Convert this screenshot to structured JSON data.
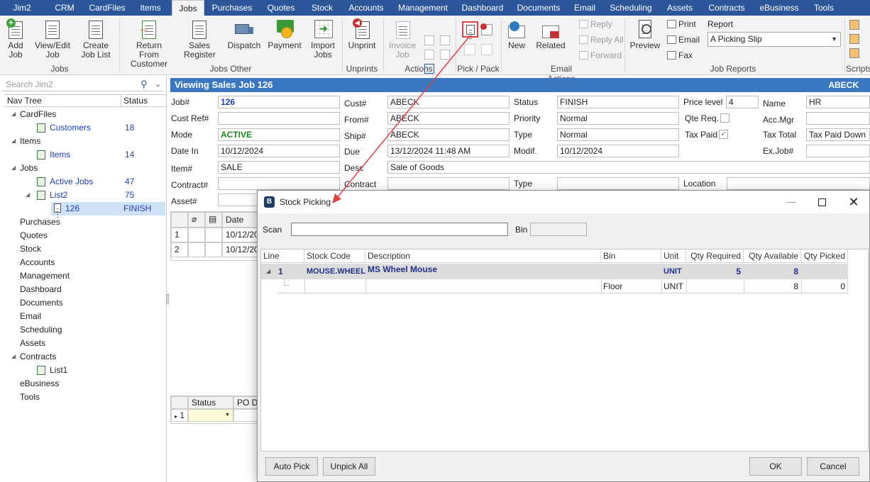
{
  "menubar": {
    "items": [
      "Jim2",
      "CRM",
      "CardFiles",
      "Items",
      "Jobs",
      "Purchases",
      "Quotes",
      "Stock",
      "Accounts",
      "Management",
      "Dashboard",
      "Documents",
      "Email",
      "Scheduling",
      "Assets",
      "Contracts",
      "eBusiness",
      "Tools"
    ],
    "active": "Jobs"
  },
  "ribbon": {
    "add_job": "Add Job",
    "view_edit_job": "View/Edit Job",
    "create_job_list": "Create Job List",
    "group_jobs": "Jobs",
    "return_from_customer": "Return From Customer",
    "sales_register": "Sales Register",
    "dispatch": "Dispatch",
    "payment": "Payment",
    "import_jobs": "Import Jobs",
    "group_jobs_other": "Jobs Other",
    "unprint": "Unprint",
    "group_unprints": "Unprints",
    "invoice_job": "Invoice Job",
    "group_actions": "Actions",
    "group_pick_pack": "Pick / Pack",
    "new": "New",
    "related": "Related",
    "reply": "Reply",
    "reply_all": "Reply All",
    "forward": "Forward",
    "group_email_actions": "Email Actions",
    "preview": "Preview",
    "print": "Print",
    "email": "Email",
    "fax": "Fax",
    "report_label": "Report",
    "report_value": "A Picking Slip",
    "group_job_reports": "Job Reports",
    "group_scripts": "Scripts"
  },
  "nav": {
    "search_placeholder": "Search Jim2",
    "col_tree": "Nav Tree",
    "col_status": "Status",
    "rows": [
      {
        "label": "CardFiles",
        "status": ""
      },
      {
        "label": "Customers",
        "status": "18"
      },
      {
        "label": "Items",
        "status": ""
      },
      {
        "label": "Items",
        "status": "14"
      },
      {
        "label": "Jobs",
        "status": ""
      },
      {
        "label": "Active Jobs",
        "status": "47"
      },
      {
        "label": "List2",
        "status": "75"
      },
      {
        "label": "126",
        "status": "FINISH"
      },
      {
        "label": "Purchases",
        "status": ""
      },
      {
        "label": "Quotes",
        "status": ""
      },
      {
        "label": "Stock",
        "status": ""
      },
      {
        "label": "Accounts",
        "status": ""
      },
      {
        "label": "Management",
        "status": ""
      },
      {
        "label": "Dashboard",
        "status": ""
      },
      {
        "label": "Documents",
        "status": ""
      },
      {
        "label": "Email",
        "status": ""
      },
      {
        "label": "Scheduling",
        "status": ""
      },
      {
        "label": "Assets",
        "status": ""
      },
      {
        "label": "Contracts",
        "status": ""
      },
      {
        "label": "List1",
        "status": ""
      },
      {
        "label": "eBusiness",
        "status": ""
      },
      {
        "label": "Tools",
        "status": ""
      }
    ]
  },
  "job": {
    "title": "Viewing Sales Job 126",
    "title_right": "ABECK",
    "labels": {
      "job_no": "Job#",
      "cust_ref": "Cust Ref#",
      "mode": "Mode",
      "date_in": "Date In",
      "item": "Item#",
      "contract": "Contract#",
      "asset": "Asset#",
      "cust": "Cust#",
      "from": "From#",
      "ship": "Ship#",
      "due": "Due",
      "desc": "Desc",
      "contract2": "Contract",
      "status": "Status",
      "priority": "Priority",
      "type": "Type",
      "modif": "Modif.",
      "type2": "Type",
      "price_level": "Price level",
      "qte_req": "Qte Req.",
      "tax_paid": "Tax Paid",
      "location": "Location",
      "name": "Name",
      "acc_mgr": "Acc.Mgr",
      "tax_total": "Tax Total",
      "ex_job": "Ex.Job#"
    },
    "values": {
      "job_no": "126",
      "cust_ref": "",
      "mode": "ACTIVE",
      "date_in": "10/12/2024",
      "item": "SALE",
      "cust": "ABECK",
      "from": "ABECK",
      "ship": "ABECK",
      "due": "13/12/2024 11:48 AM",
      "desc": "Sale of Goods",
      "status": "FINISH",
      "priority": "Normal",
      "type": "Normal",
      "modif": "10/12/2024",
      "price_level": "4",
      "tax_paid_check": "✓",
      "name": "HR",
      "tax_total": "Tax Paid Down"
    }
  },
  "left_grid": {
    "date_header": "Date",
    "rows": [
      {
        "n": "1",
        "date": "10/12/2024"
      },
      {
        "n": "2",
        "date": "10/12/2024"
      }
    ]
  },
  "lower_grid": {
    "status_header": "Status",
    "po_due_header": "PO Due",
    "row_no": "1"
  },
  "dialog": {
    "title": "Stock Picking",
    "scan_label": "Scan",
    "scan_value": "",
    "bin_label": "Bin",
    "bin_value": "",
    "columns": [
      "Line",
      "Stock Code",
      "Description",
      "Bin",
      "Unit",
      "Qty Required",
      "Qty Available",
      "Qty Picked"
    ],
    "main_row": {
      "line": "1",
      "stock_code": "MOUSE.WHEEL",
      "description": "MS Wheel Mouse",
      "bin": "",
      "unit": "UNIT",
      "qty_required": "5",
      "qty_available": "8",
      "qty_picked": ""
    },
    "sub_row": {
      "bin": "Floor",
      "unit": "UNIT",
      "qty_available": "8",
      "qty_picked": "0"
    },
    "auto_pick": "Auto Pick",
    "unpick_all": "Unpick All",
    "ok": "OK",
    "cancel": "Cancel"
  },
  "colors": {
    "menubar": "#2b579a",
    "titlebar": "#3c78c2",
    "link": "#1c3fb7",
    "active_mode": "#1a8a1a",
    "arrow": "#e04040"
  }
}
